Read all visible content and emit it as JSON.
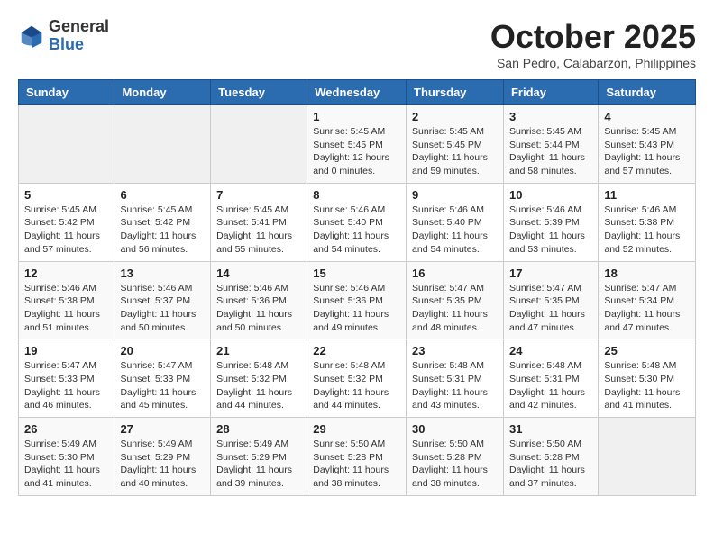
{
  "logo": {
    "general": "General",
    "blue": "Blue"
  },
  "title": "October 2025",
  "subtitle": "San Pedro, Calabarzon, Philippines",
  "days_header": [
    "Sunday",
    "Monday",
    "Tuesday",
    "Wednesday",
    "Thursday",
    "Friday",
    "Saturday"
  ],
  "weeks": [
    [
      {
        "day": "",
        "info": ""
      },
      {
        "day": "",
        "info": ""
      },
      {
        "day": "",
        "info": ""
      },
      {
        "day": "1",
        "info": "Sunrise: 5:45 AM\nSunset: 5:45 PM\nDaylight: 12 hours\nand 0 minutes."
      },
      {
        "day": "2",
        "info": "Sunrise: 5:45 AM\nSunset: 5:45 PM\nDaylight: 11 hours\nand 59 minutes."
      },
      {
        "day": "3",
        "info": "Sunrise: 5:45 AM\nSunset: 5:44 PM\nDaylight: 11 hours\nand 58 minutes."
      },
      {
        "day": "4",
        "info": "Sunrise: 5:45 AM\nSunset: 5:43 PM\nDaylight: 11 hours\nand 57 minutes."
      }
    ],
    [
      {
        "day": "5",
        "info": "Sunrise: 5:45 AM\nSunset: 5:42 PM\nDaylight: 11 hours\nand 57 minutes."
      },
      {
        "day": "6",
        "info": "Sunrise: 5:45 AM\nSunset: 5:42 PM\nDaylight: 11 hours\nand 56 minutes."
      },
      {
        "day": "7",
        "info": "Sunrise: 5:45 AM\nSunset: 5:41 PM\nDaylight: 11 hours\nand 55 minutes."
      },
      {
        "day": "8",
        "info": "Sunrise: 5:46 AM\nSunset: 5:40 PM\nDaylight: 11 hours\nand 54 minutes."
      },
      {
        "day": "9",
        "info": "Sunrise: 5:46 AM\nSunset: 5:40 PM\nDaylight: 11 hours\nand 54 minutes."
      },
      {
        "day": "10",
        "info": "Sunrise: 5:46 AM\nSunset: 5:39 PM\nDaylight: 11 hours\nand 53 minutes."
      },
      {
        "day": "11",
        "info": "Sunrise: 5:46 AM\nSunset: 5:38 PM\nDaylight: 11 hours\nand 52 minutes."
      }
    ],
    [
      {
        "day": "12",
        "info": "Sunrise: 5:46 AM\nSunset: 5:38 PM\nDaylight: 11 hours\nand 51 minutes."
      },
      {
        "day": "13",
        "info": "Sunrise: 5:46 AM\nSunset: 5:37 PM\nDaylight: 11 hours\nand 50 minutes."
      },
      {
        "day": "14",
        "info": "Sunrise: 5:46 AM\nSunset: 5:36 PM\nDaylight: 11 hours\nand 50 minutes."
      },
      {
        "day": "15",
        "info": "Sunrise: 5:46 AM\nSunset: 5:36 PM\nDaylight: 11 hours\nand 49 minutes."
      },
      {
        "day": "16",
        "info": "Sunrise: 5:47 AM\nSunset: 5:35 PM\nDaylight: 11 hours\nand 48 minutes."
      },
      {
        "day": "17",
        "info": "Sunrise: 5:47 AM\nSunset: 5:35 PM\nDaylight: 11 hours\nand 47 minutes."
      },
      {
        "day": "18",
        "info": "Sunrise: 5:47 AM\nSunset: 5:34 PM\nDaylight: 11 hours\nand 47 minutes."
      }
    ],
    [
      {
        "day": "19",
        "info": "Sunrise: 5:47 AM\nSunset: 5:33 PM\nDaylight: 11 hours\nand 46 minutes."
      },
      {
        "day": "20",
        "info": "Sunrise: 5:47 AM\nSunset: 5:33 PM\nDaylight: 11 hours\nand 45 minutes."
      },
      {
        "day": "21",
        "info": "Sunrise: 5:48 AM\nSunset: 5:32 PM\nDaylight: 11 hours\nand 44 minutes."
      },
      {
        "day": "22",
        "info": "Sunrise: 5:48 AM\nSunset: 5:32 PM\nDaylight: 11 hours\nand 44 minutes."
      },
      {
        "day": "23",
        "info": "Sunrise: 5:48 AM\nSunset: 5:31 PM\nDaylight: 11 hours\nand 43 minutes."
      },
      {
        "day": "24",
        "info": "Sunrise: 5:48 AM\nSunset: 5:31 PM\nDaylight: 11 hours\nand 42 minutes."
      },
      {
        "day": "25",
        "info": "Sunrise: 5:48 AM\nSunset: 5:30 PM\nDaylight: 11 hours\nand 41 minutes."
      }
    ],
    [
      {
        "day": "26",
        "info": "Sunrise: 5:49 AM\nSunset: 5:30 PM\nDaylight: 11 hours\nand 41 minutes."
      },
      {
        "day": "27",
        "info": "Sunrise: 5:49 AM\nSunset: 5:29 PM\nDaylight: 11 hours\nand 40 minutes."
      },
      {
        "day": "28",
        "info": "Sunrise: 5:49 AM\nSunset: 5:29 PM\nDaylight: 11 hours\nand 39 minutes."
      },
      {
        "day": "29",
        "info": "Sunrise: 5:50 AM\nSunset: 5:28 PM\nDaylight: 11 hours\nand 38 minutes."
      },
      {
        "day": "30",
        "info": "Sunrise: 5:50 AM\nSunset: 5:28 PM\nDaylight: 11 hours\nand 38 minutes."
      },
      {
        "day": "31",
        "info": "Sunrise: 5:50 AM\nSunset: 5:28 PM\nDaylight: 11 hours\nand 37 minutes."
      },
      {
        "day": "",
        "info": ""
      }
    ]
  ]
}
